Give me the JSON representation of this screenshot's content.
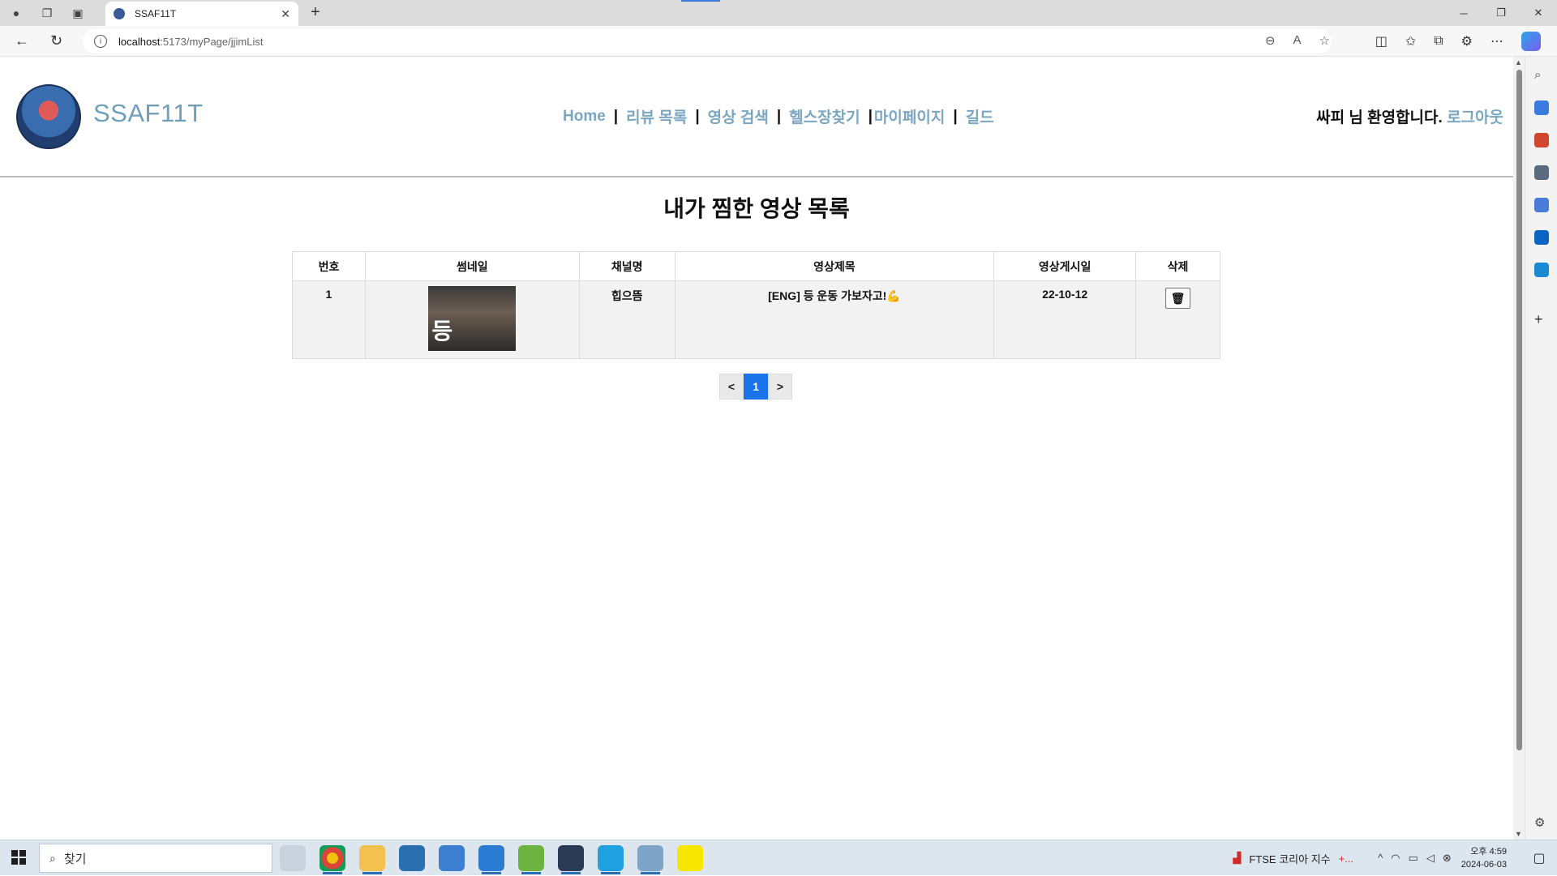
{
  "browser": {
    "tab_title": "SSAF11T",
    "url_host": "localhost",
    "url_path": ":5173/myPage/jjimList"
  },
  "site": {
    "brand": "SSAF11T",
    "nav": [
      "Home",
      "리뷰 목록",
      "영상 검색",
      "헬스장찾기",
      "마이페이지",
      "길드"
    ],
    "welcome": "싸피 님 환영합니다.",
    "logout": "로그아웃"
  },
  "page": {
    "title": "내가 찜한 영상 목록",
    "columns": [
      "번호",
      "썸네일",
      "채널명",
      "영상제목",
      "영상게시일",
      "삭제"
    ],
    "rows": [
      {
        "no": "1",
        "thumb_text": "등",
        "channel": "힙으뜸",
        "title": "[ENG] 등 운동 가보자고!💪",
        "date": "22-10-12",
        "delete_icon": "trash-icon"
      }
    ],
    "pager": {
      "prev": "<",
      "current": "1",
      "next": ">"
    }
  },
  "taskbar": {
    "search_placeholder": "찾기",
    "stock_label": "FTSE 코리아 지수",
    "stock_change": "+...",
    "time": "오후 4:59",
    "date": "2024-06-03"
  },
  "colors": {
    "accent_link": "#7aa6c2",
    "pager_active": "#1a73e8"
  }
}
